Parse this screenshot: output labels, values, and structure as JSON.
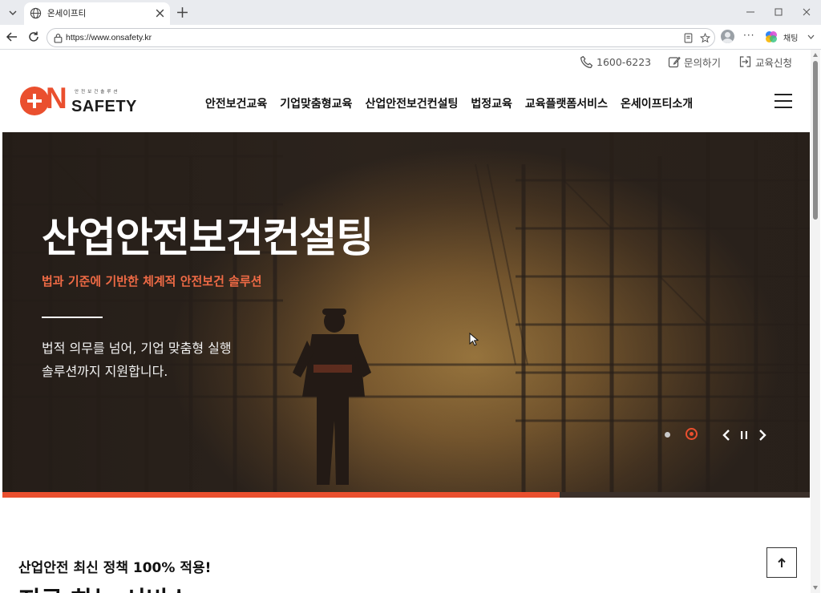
{
  "browser": {
    "tab_title": "온세이프티",
    "url": "https://www.onsafety.kr",
    "copilot_label": "채팅"
  },
  "utility": {
    "phone": "1600-6223",
    "inquiry": "문의하기",
    "apply": "교육신청"
  },
  "logo": {
    "on": "ON",
    "tagline": "안전보건솔루션",
    "wordmark": "SAFETY"
  },
  "gnb": [
    {
      "label": "안전보건교육"
    },
    {
      "label": "기업맞춤형교육"
    },
    {
      "label": "산업안전보건컨설팅"
    },
    {
      "label": "법정교육"
    },
    {
      "label": "교육플랫폼서비스"
    },
    {
      "label": "온세이프티소개"
    }
  ],
  "hero": {
    "title": "산업안전보건컨설팅",
    "subtitle": "법과 기준에 기반한 체계적 안전보건 솔루션",
    "desc_line1": "법적 의무를 넘어, 기업 맞춤형 실행",
    "desc_line2": "솔루션까지 지원합니다.",
    "slide_count": 2,
    "active_slide": 2,
    "progress": 0.69
  },
  "section": {
    "kicker": "산업안전 최신 정책 100% 적용!",
    "heading_partial": "지금 하는 서비스"
  },
  "colors": {
    "brand": "#ea4f2e",
    "text": "#111111"
  }
}
